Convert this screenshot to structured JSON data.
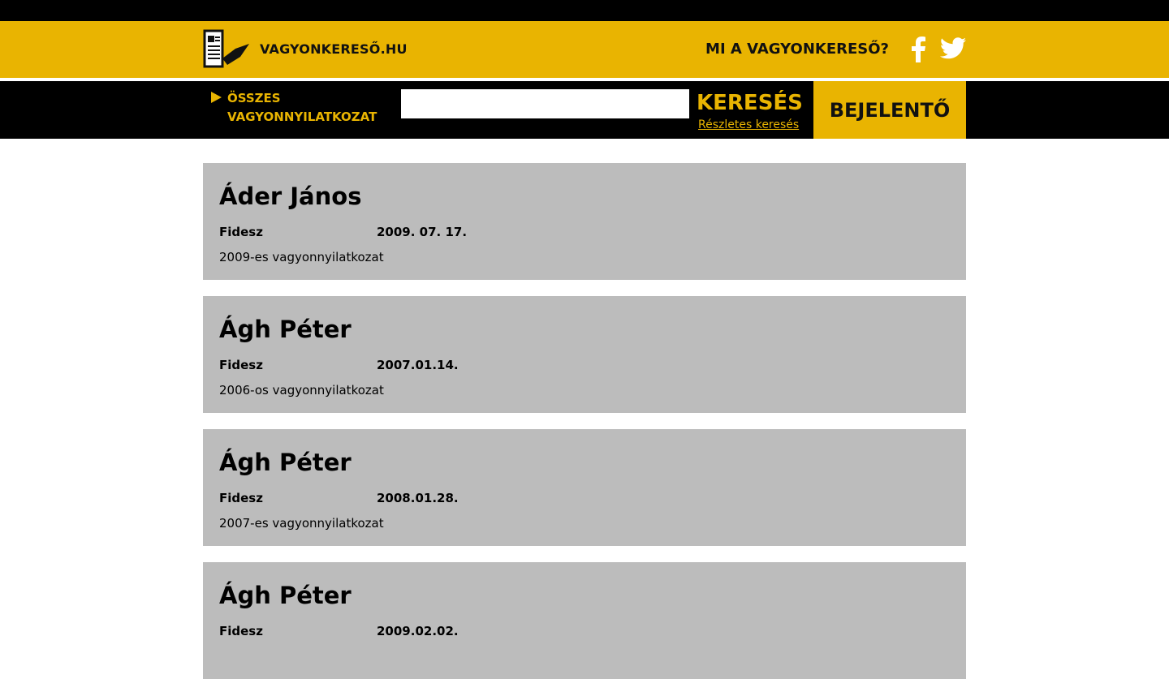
{
  "header": {
    "site_title": "VAGYONKERESŐ.HU",
    "about_label": "MI A VAGYONKERESŐ?",
    "facebook_icon": "facebook-icon",
    "twitter_icon": "twitter-icon",
    "brand_color": "#e9b401"
  },
  "searchbar": {
    "all_label_line1": "ÖSSZES",
    "all_label_line2": "VAGYONNYILATKOZAT",
    "search_value": "",
    "search_button": "KERESÉS",
    "advanced_link": "Részletes keresés",
    "report_button": "BEJELENTŐ"
  },
  "results": [
    {
      "name": "Áder János",
      "party": "Fidesz",
      "date": "2009. 07. 17.",
      "description": "2009-es vagyonnyilatkozat"
    },
    {
      "name": "Ágh Péter",
      "party": "Fidesz",
      "date": "2007.01.14.",
      "description": "2006-os vagyonnyilatkozat"
    },
    {
      "name": "Ágh Péter",
      "party": "Fidesz",
      "date": "2008.01.28.",
      "description": "2007-es vagyonnyilatkozat"
    },
    {
      "name": "Ágh Péter",
      "party": "Fidesz",
      "date": "2009.02.02.",
      "description": ""
    }
  ]
}
